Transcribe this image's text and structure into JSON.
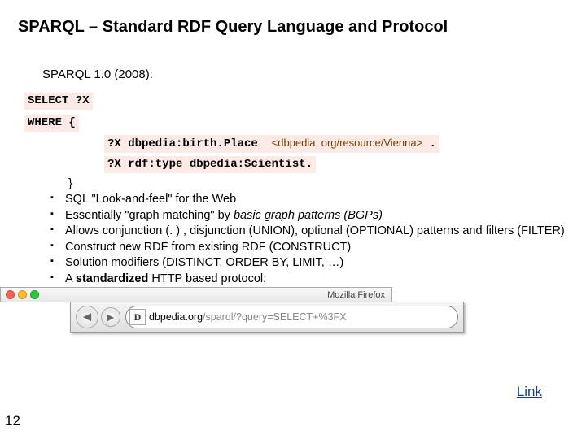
{
  "title": "SPARQL – Standard RDF Query Language and Protocol",
  "subtitle": "SPARQL 1.0 (2008):",
  "code": {
    "select": "SELECT ?X",
    "where": "WHERE {",
    "triple1a": "?X dbpedia:birth.Place  ",
    "triple1b": "<dbpedia. org/resource/Vienna>",
    "triple1c": " .",
    "triple2": "?X rdf:type dbpedia:Scientist.",
    "close": "}"
  },
  "bullets": [
    {
      "html": "SQL \"Look-and-feel\" for the Web"
    },
    {
      "html": "Essentially \"graph matching\" by <span class='italic'>basic graph patterns (BGPs)</span>"
    },
    {
      "html": "Allows conjunction (. ) , disjunction (UNION), optional (OPTIONAL) patterns and filters (FILTER)"
    },
    {
      "html": "Construct new RDF from existing RDF (CONSTRUCT)"
    },
    {
      "html": "Solution modifiers (DISTINCT, ORDER BY, LIMIT, …)"
    },
    {
      "html": "A <b>standardized</b> HTTP based protocol:"
    }
  ],
  "browser": {
    "title": "Mozilla Firefox",
    "favicon": "D",
    "host": "dbpedia.org",
    "path": "/sparql/?query=SELECT+%3FX"
  },
  "link": "Link",
  "pageNumber": "12"
}
